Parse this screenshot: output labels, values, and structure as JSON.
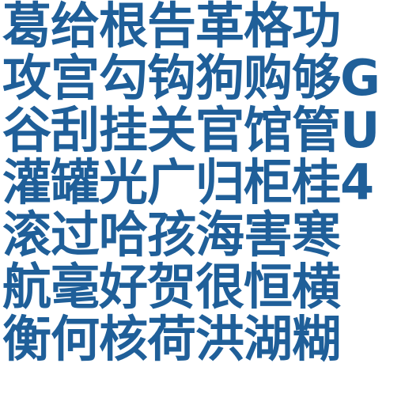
{
  "lines": [
    "葛给根告革格功",
    "攻宫勾钩狗购够G",
    "谷刮挂关官馆管U",
    "灌罐光广归柜桂4",
    "滚过哈孩海害寒",
    "航毫好贺很恒横",
    "衡何核荷洪湖糊"
  ],
  "colors": {
    "text": "#1f5f99",
    "background": "#ffffff"
  }
}
